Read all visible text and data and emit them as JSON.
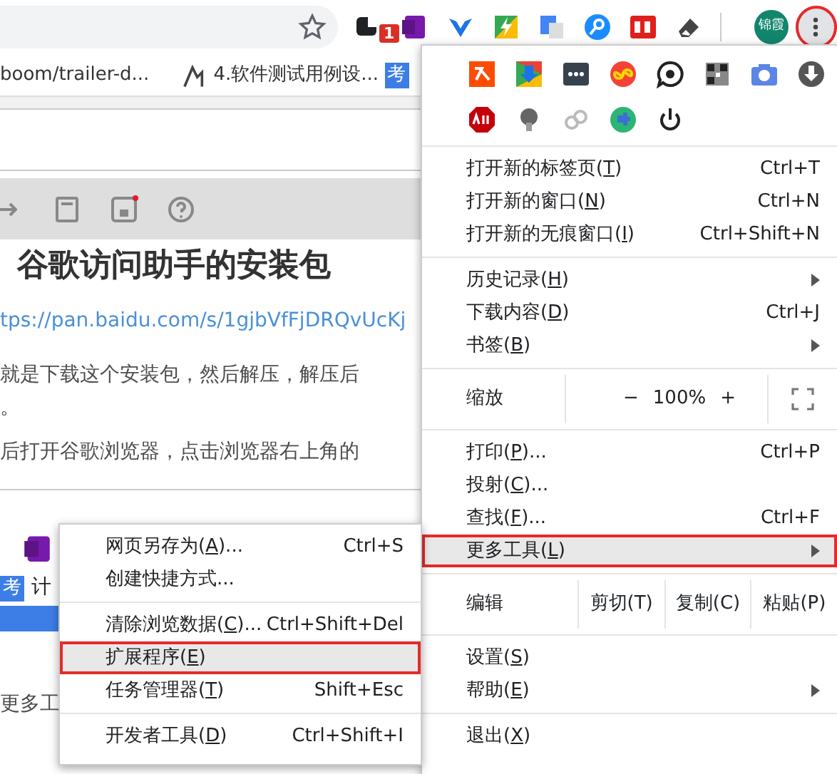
{
  "toolbar": {
    "extension_badge": "1",
    "avatar": "锦霞",
    "menu_highlighted": true
  },
  "bookmarks": [
    {
      "text": "boom/trailer-d..."
    },
    {
      "text": "4.软件测试用例设..."
    },
    {
      "text": "考"
    }
  ],
  "article": {
    "heading": "谷歌访问助手的安装包",
    "link": "tps://pan.baidu.com/s/1gjbVfFjDRQvUcKj",
    "lines": [
      "就是下载这个安装包，然后解压，解压后",
      "。",
      "后打开谷歌浏览器，点击浏览器右上角的"
    ],
    "lower_tag": "考",
    "lower_text": "计",
    "lower_more": "更多工"
  },
  "menu": {
    "items": [
      {
        "kind": "item",
        "before": "打开新的标签页(",
        "key": "T",
        "after": ")",
        "shortcut": "Ctrl+T",
        "submenu": false,
        "highlighted": false
      },
      {
        "kind": "item",
        "before": "打开新的窗口(",
        "key": "N",
        "after": ")",
        "shortcut": "Ctrl+N",
        "submenu": false,
        "highlighted": false
      },
      {
        "kind": "item",
        "before": "打开新的无痕窗口(",
        "key": "I",
        "after": ")",
        "shortcut": "Ctrl+Shift+N",
        "submenu": false,
        "highlighted": false
      },
      {
        "kind": "separator"
      },
      {
        "kind": "item",
        "before": "历史记录(",
        "key": "H",
        "after": ")",
        "submenu": true,
        "highlighted": false
      },
      {
        "kind": "item",
        "before": "下载内容(",
        "key": "D",
        "after": ")",
        "shortcut": "Ctrl+J",
        "submenu": false,
        "highlighted": false
      },
      {
        "kind": "item",
        "before": "书签(",
        "key": "B",
        "after": ")",
        "submenu": true,
        "highlighted": false
      },
      {
        "kind": "separator"
      },
      {
        "kind": "zoom",
        "label": "缩放",
        "minus": "−",
        "value": "100%",
        "plus": "+"
      },
      {
        "kind": "separator"
      },
      {
        "kind": "item",
        "before": "打印(",
        "key": "P",
        "after": ")...",
        "shortcut": "Ctrl+P",
        "submenu": false,
        "highlighted": false
      },
      {
        "kind": "item",
        "before": "投射(",
        "key": "C",
        "after": ")...",
        "submenu": false,
        "highlighted": false
      },
      {
        "kind": "item",
        "before": "查找(",
        "key": "F",
        "after": ")...",
        "shortcut": "Ctrl+F",
        "submenu": false,
        "highlighted": false
      },
      {
        "kind": "item",
        "before": "更多工具(",
        "key": "L",
        "after": ")",
        "submenu": true,
        "highlighted": true
      },
      {
        "kind": "separator"
      },
      {
        "kind": "edit",
        "label": "编辑",
        "buttons": [
          "剪切(T)",
          "复制(C)",
          "粘贴(P)"
        ]
      },
      {
        "kind": "separator"
      },
      {
        "kind": "item",
        "before": "设置(",
        "key": "S",
        "after": ")",
        "submenu": false,
        "highlighted": false
      },
      {
        "kind": "item",
        "before": "帮助(",
        "key": "E",
        "after": ")",
        "submenu": true,
        "highlighted": false
      },
      {
        "kind": "separator"
      },
      {
        "kind": "item",
        "before": "退出(",
        "key": "X",
        "after": ")",
        "submenu": false,
        "highlighted": false
      }
    ]
  },
  "submenu": {
    "items": [
      {
        "kind": "item",
        "before": "网页另存为(",
        "key": "A",
        "after": ")...",
        "shortcut": "Ctrl+S",
        "highlighted": false
      },
      {
        "kind": "item",
        "before": "创建快捷方式...",
        "highlighted": false
      },
      {
        "kind": "separator"
      },
      {
        "kind": "item",
        "before": "清除浏览数据(",
        "key": "C",
        "after": ")...",
        "shortcut": "Ctrl+Shift+Del",
        "highlighted": false
      },
      {
        "kind": "item",
        "before": "扩展程序(",
        "key": "E",
        "after": ")",
        "highlighted": true
      },
      {
        "kind": "item",
        "before": "任务管理器(",
        "key": "T",
        "after": ")",
        "shortcut": "Shift+Esc",
        "highlighted": false
      },
      {
        "kind": "separator"
      },
      {
        "kind": "item",
        "before": "开发者工具(",
        "key": "D",
        "after": ")",
        "shortcut": "Ctrl+Shift+I",
        "highlighted": false
      }
    ]
  }
}
